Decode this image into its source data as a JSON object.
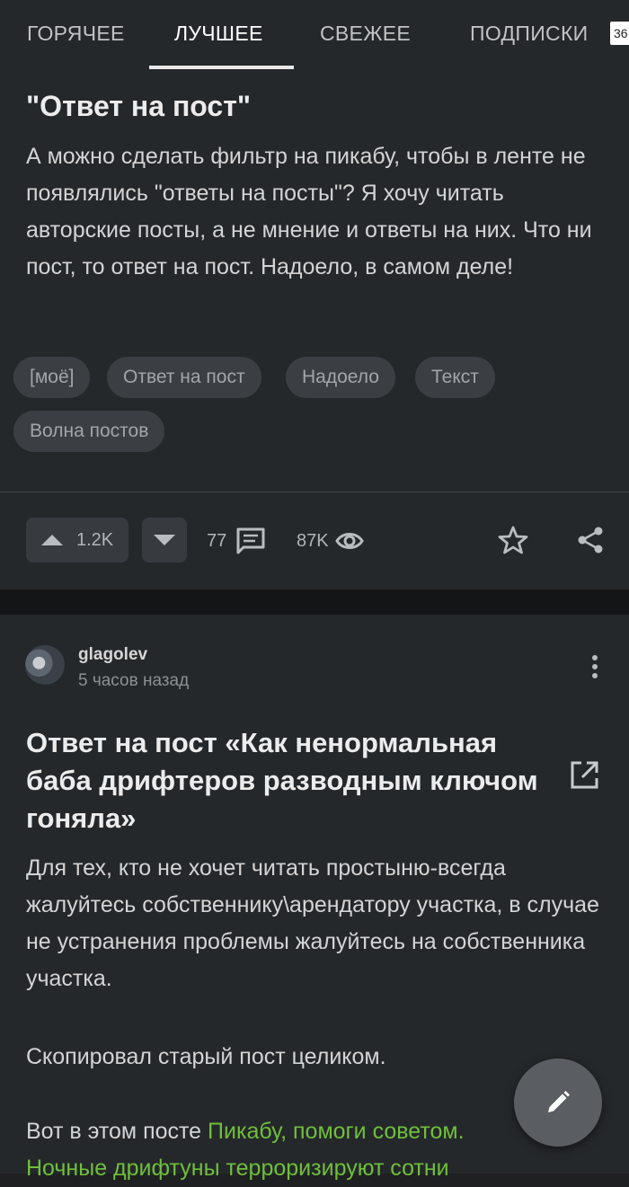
{
  "tabs": [
    {
      "label": "ГОРЯЧЕЕ"
    },
    {
      "label": "ЛУЧШЕЕ"
    },
    {
      "label": "СВЕЖЕЕ"
    },
    {
      "label": "ПОДПИСКИ"
    }
  ],
  "active_tab_index": 1,
  "tab_badge": "36",
  "post1": {
    "title": "\"Ответ на пост\"",
    "text": "А можно сделать фильтр на пикабу, чтобы в ленте не появлялись \"ответы на посты\"? Я хочу читать авторские посты, а не мнение и ответы на них. Что ни пост, то ответ на пост. Надоело, в самом деле!",
    "tags": [
      "[моё]",
      "Ответ на пост",
      "Надоело",
      "Текст",
      "Волна постов"
    ],
    "rating": "1.2K",
    "comments": "77",
    "views": "87K"
  },
  "post2": {
    "author": "glagolev",
    "time": "5 часов назад",
    "title": "Ответ на пост «Как ненормальная баба дрифтеров разводным ключом гоняла»",
    "paragraph1": "Для тех, кто не хочет читать простыню-всегда жалуйтесь собственнику\\арендатору участка, в случае не устранения проблемы жалуйтесь на собственника участка.",
    "paragraph2": "Скопировал старый пост целиком.",
    "paragraph3_prefix": "Вот в этом  посте ",
    "paragraph3_link_line1": "Пикабу, помоги советом.",
    "paragraph3_link_line2": "Ночные дрифтуны терроризируют сотни"
  },
  "icons": {
    "upvote": "arrow-up-icon",
    "downvote": "arrow-down-icon",
    "comments": "comment-icon",
    "views": "eye-icon",
    "save": "star-icon",
    "share": "share-icon",
    "more": "more-vertical-icon",
    "external": "open-external-icon",
    "edit": "pencil-icon"
  },
  "colors": {
    "background": "#1e2022",
    "card": "#25282b",
    "link": "#6fbf3b",
    "tag_bg": "#3b3f44"
  }
}
